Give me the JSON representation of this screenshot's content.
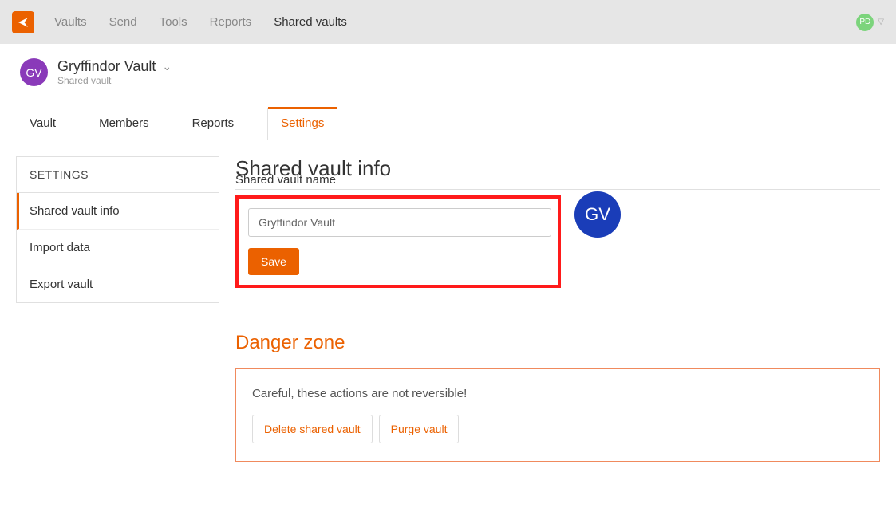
{
  "topnav": {
    "items": [
      "Vaults",
      "Send",
      "Tools",
      "Reports",
      "Shared vaults"
    ],
    "active": 4
  },
  "user": {
    "initials": "PD"
  },
  "vault": {
    "avatar": "GV",
    "name": "Gryffindor Vault",
    "subtitle": "Shared vault"
  },
  "tabs": {
    "items": [
      "Vault",
      "Members",
      "Reports",
      "Settings"
    ],
    "active": 3
  },
  "sidebar": {
    "heading": "SETTINGS",
    "items": [
      "Shared vault info",
      "Import data",
      "Export vault"
    ],
    "active": 0
  },
  "main": {
    "title": "Shared vault info",
    "name_label": "Shared vault name",
    "name_value": "Gryffindor Vault",
    "save_label": "Save",
    "big_avatar": "GV"
  },
  "danger": {
    "title": "Danger zone",
    "warning": "Careful, these actions are not reversible!",
    "delete_label": "Delete shared vault",
    "purge_label": "Purge vault"
  }
}
